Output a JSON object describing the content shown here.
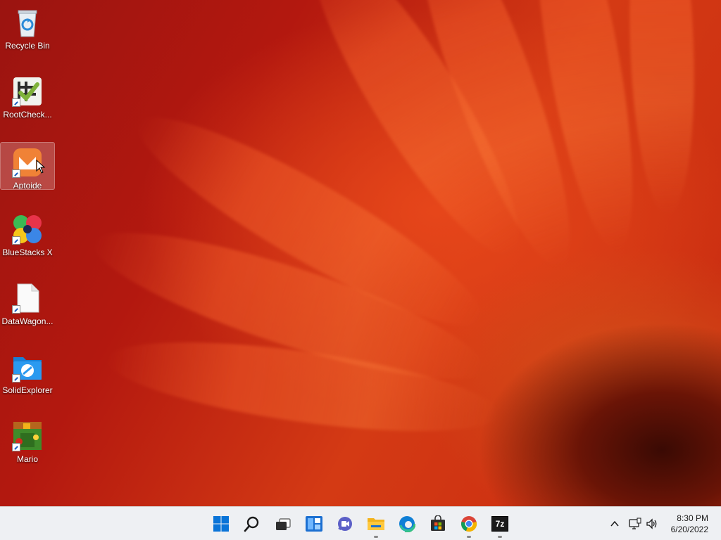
{
  "desktop": {
    "icons": [
      {
        "label": "Recycle Bin",
        "icon": "recycle-bin-icon"
      },
      {
        "label": "RootCheck...",
        "icon": "rootchecker-icon"
      },
      {
        "label": "Aptoide",
        "icon": "aptoide-icon"
      },
      {
        "label": "BlueStacks X",
        "icon": "bluestacks-icon"
      },
      {
        "label": "DataWagon...",
        "icon": "file-icon"
      },
      {
        "label": "SolidExplorer",
        "icon": "solid-explorer-icon"
      },
      {
        "label": "Mario",
        "icon": "mario-icon"
      }
    ]
  },
  "taskbar": {
    "apps": [
      "start-icon",
      "search-icon",
      "task-view-icon",
      "widgets-icon",
      "chat-icon",
      "file-explorer-icon",
      "edge-icon",
      "store-icon",
      "chrome-icon",
      "7zip-icon"
    ],
    "sevenzip_label": "7z"
  },
  "tray": {
    "time": "8:30 PM",
    "date": "6/20/2022",
    "icons": [
      "chevron-up-icon",
      "network-icon",
      "volume-icon"
    ]
  },
  "colors": {
    "taskbar_bg": "#eef0f3",
    "wallpaper_main": "#c8240f",
    "start_blue": "#0a74d8"
  }
}
